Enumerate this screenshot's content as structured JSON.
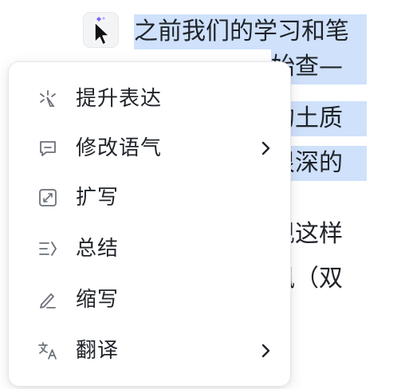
{
  "document": {
    "lines": [
      "之前我们的学习和笔",
      "始查—",
      "的土质",
      "很深的",
      "现这样",
      "讯（双"
    ]
  },
  "ai_button": {
    "icon": "magic-wand-icon",
    "cursor": "arrow-cursor-icon"
  },
  "menu": {
    "items": [
      {
        "label": "提升表达",
        "icon": "sparkle-icon",
        "has_submenu": false
      },
      {
        "label": "修改语气",
        "icon": "speech-bubble-icon",
        "has_submenu": true
      },
      {
        "label": "扩写",
        "icon": "expand-icon",
        "has_submenu": false
      },
      {
        "label": "总结",
        "icon": "summary-icon",
        "has_submenu": false
      },
      {
        "label": "缩写",
        "icon": "pencil-icon",
        "has_submenu": false
      },
      {
        "label": "翻译",
        "icon": "translate-icon",
        "has_submenu": true
      }
    ]
  },
  "colors": {
    "selection": "#cfe1fb",
    "text": "#1f2329",
    "icon": "#6b7079",
    "accent": "#7b61ff"
  }
}
